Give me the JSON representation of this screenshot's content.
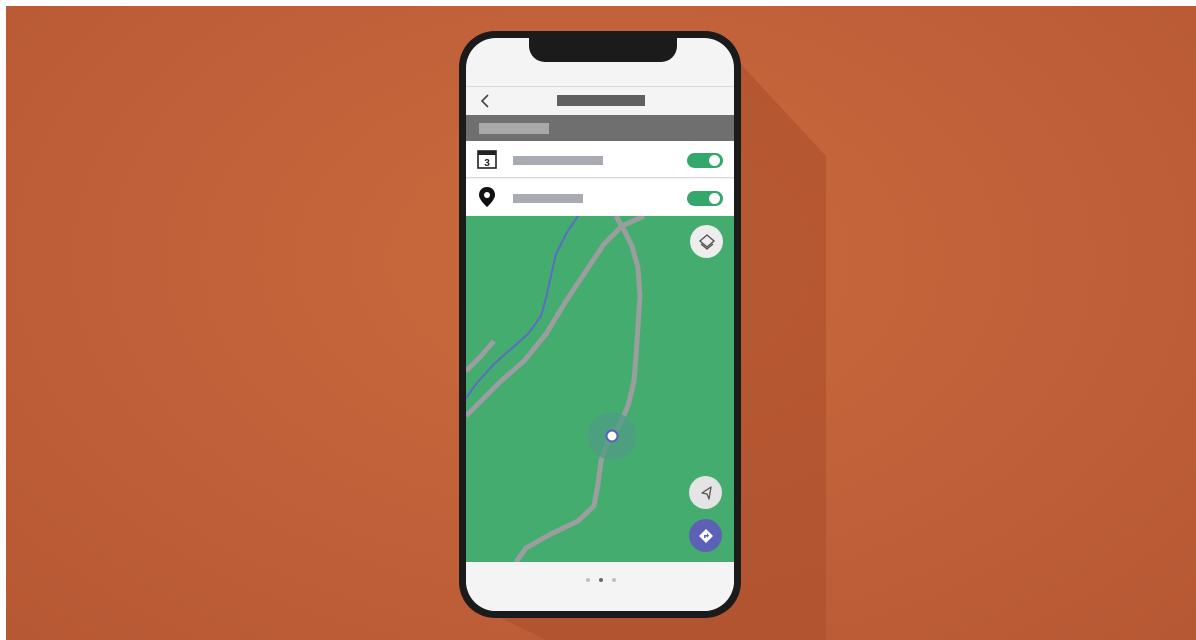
{
  "app": {
    "screen_title": "",
    "section_label": ""
  },
  "settings": [
    {
      "icon": "calendar-icon",
      "calendar_day": "3",
      "label": "",
      "enabled": true
    },
    {
      "icon": "location-pin-icon",
      "label": "",
      "enabled": true
    }
  ],
  "map": {
    "controls": [
      "layers-icon",
      "locate-arrow-icon",
      "directions-icon"
    ]
  },
  "pager": {
    "pages": 3,
    "active_index": 1
  },
  "colors": {
    "background": "#c0603a",
    "toggle_on": "#34a86a",
    "map_land": "#45ac6f",
    "map_road": "#9a9e9f",
    "map_river": "#5a6cc4",
    "accent": "#5d61b5"
  }
}
